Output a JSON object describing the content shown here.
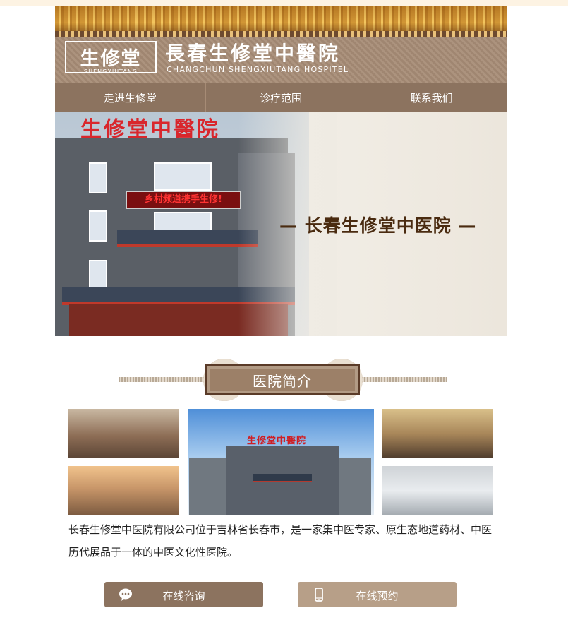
{
  "header": {
    "logo_text": "生修堂",
    "logo_pinyin": "SHENGXIUTANG",
    "hospital_name_cn": "長春生修堂中醫院",
    "hospital_name_en": "CHANGCHUN SHENGXIUTANG HOSPITEL"
  },
  "nav": {
    "items": [
      {
        "label": "走进生修堂"
      },
      {
        "label": "诊疗范围"
      },
      {
        "label": "联系我们"
      }
    ]
  },
  "banner": {
    "building_sign": "生修堂中醫院",
    "led_text": "乡村频道携手生修!",
    "title": "— 长春生修堂中医院 —"
  },
  "section": {
    "title": "医院简介"
  },
  "photos": {
    "center_sign": "生修堂中醫院"
  },
  "intro": {
    "text": "长春生修堂中医院有限公司位于吉林省长春市，是一家集中医专家、原生态地道药材、中医历代展品于一体的中医文化性医院。"
  },
  "buttons": {
    "consult_label": "在线咨询",
    "appointment_label": "在线预约"
  },
  "colors": {
    "brand_brown": "#8c735f",
    "light_brown": "#b79f88",
    "title_brown": "#4a2b10"
  },
  "icons": {
    "consult_icon": "chat-bubble-icon",
    "appointment_icon": "mobile-phone-icon"
  }
}
